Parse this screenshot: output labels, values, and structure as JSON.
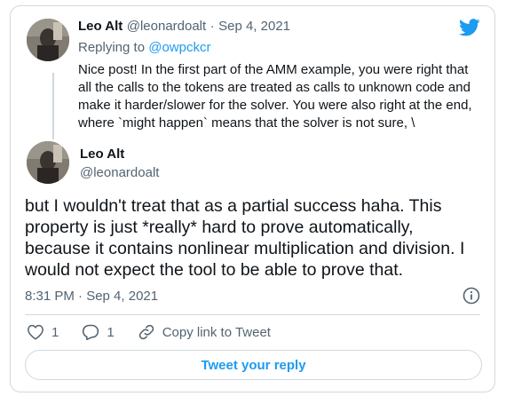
{
  "reply_tweet": {
    "author_name": "Leo Alt",
    "author_handle": "@leonardoalt",
    "separator": "·",
    "date": "Sep 4, 2021",
    "replying_to_label": "Replying to",
    "replying_to_handle": "@owpckcr",
    "text_lines": [
      "Nice post! In the first part of the AMM example, you were right that",
      "all the calls to the tokens are treated as calls to unknown code and",
      "make it harder/slower for the solver. You were also right at the end,",
      "where `might happen` means that the solver is not sure, \\"
    ]
  },
  "main_tweet": {
    "author_name": "Leo Alt",
    "author_handle": "@leonardoalt",
    "text_lines": [
      "but I wouldn't treat that as a partial success haha. This",
      "property is just *really* hard to prove automatically,",
      "because it contains nonlinear multiplication and division. I",
      "would not expect the tool to be able to prove that."
    ],
    "timestamp": "8:31 PM · Sep 4, 2021"
  },
  "actions": {
    "like_count": "1",
    "reply_count": "1",
    "copy_link_label": "Copy link to Tweet"
  },
  "reply_button_label": "Tweet your reply",
  "colors": {
    "accent": "#1d9bf0",
    "text": "#0f1419",
    "muted": "#536471",
    "border": "#cfd9de"
  },
  "icons": [
    "twitter-bird-icon",
    "info-icon",
    "heart-icon",
    "reply-bubble-icon",
    "link-icon"
  ]
}
